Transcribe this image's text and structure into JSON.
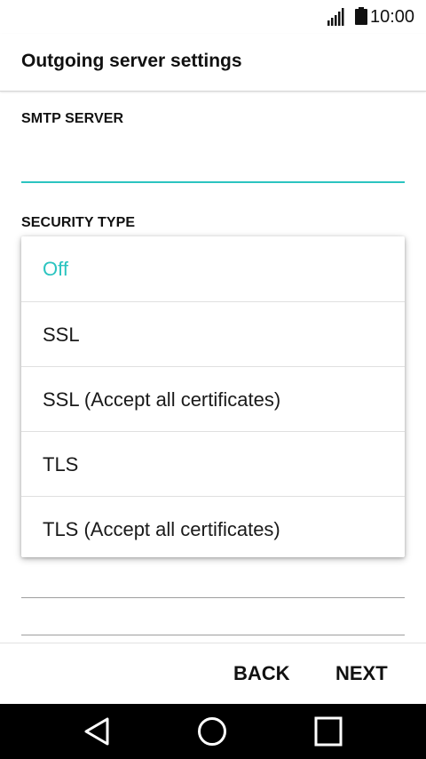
{
  "status_bar": {
    "time": "10:00",
    "icons": [
      "signal-icon",
      "battery-icon"
    ]
  },
  "header": {
    "title": "Outgoing server settings"
  },
  "form": {
    "smtp_server": {
      "label": "SMTP SERVER",
      "value": ""
    },
    "security_type": {
      "label": "SECURITY TYPE",
      "selected": "Off"
    }
  },
  "security_menu": {
    "options": [
      "Off",
      "SSL",
      "SSL (Accept all certificates)",
      "TLS",
      "TLS (Accept all certificates)"
    ],
    "selected_color": "#2bc4c0"
  },
  "footer": {
    "back_label": "BACK",
    "next_label": "NEXT"
  },
  "nav_bar": {
    "icons": [
      "back-triangle-icon",
      "home-circle-icon",
      "recents-square-icon"
    ]
  },
  "colors": {
    "accent": "#2bc4c0",
    "nav_background": "#000000"
  }
}
